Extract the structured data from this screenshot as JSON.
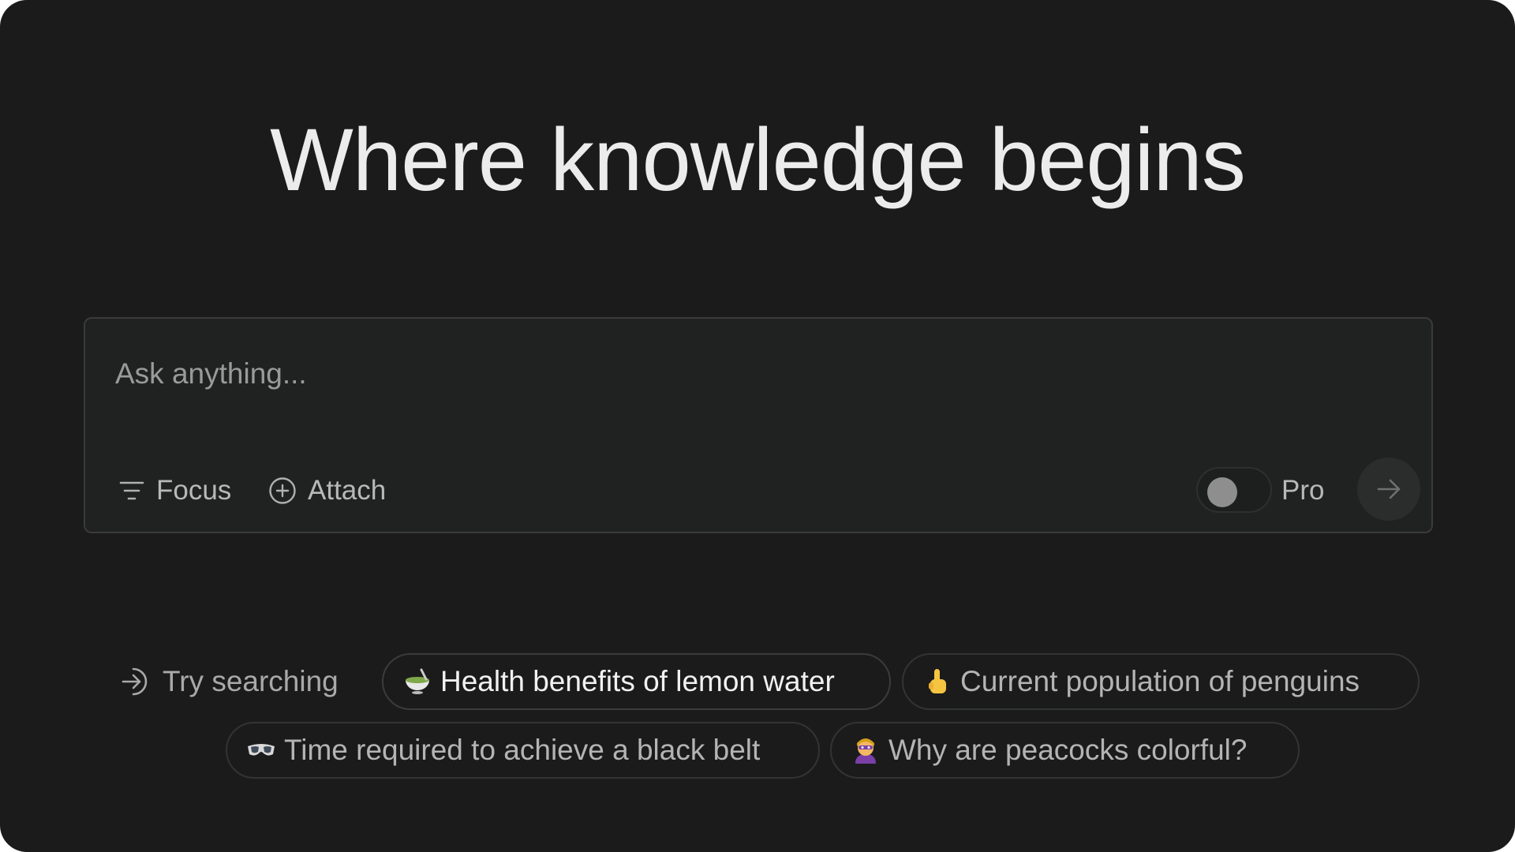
{
  "hero": {
    "title": "Where knowledge begins"
  },
  "ask": {
    "placeholder": "Ask anything...",
    "value": "",
    "focus_label": "Focus",
    "attach_label": "Attach",
    "pro_label": "Pro",
    "pro_enabled": false
  },
  "suggestions": {
    "label": "Try searching",
    "chips": [
      {
        "emoji": "bowl-with-spoon",
        "text": "Health benefits of lemon water",
        "hovered": true
      },
      {
        "emoji": "backhand-index-pointing-up",
        "text": "Current population of penguins",
        "hovered": false
      },
      {
        "emoji": "goggles",
        "text": "Time required to achieve a black belt",
        "hovered": false
      },
      {
        "emoji": "superhero",
        "text": "Why are peacocks colorful?",
        "hovered": false
      }
    ]
  },
  "colors": {
    "background": "#1b1b1b",
    "input_background": "#202222",
    "border": "#3a3a3a",
    "text_primary": "#ececec",
    "text_secondary": "#b4b4b4"
  },
  "icons": [
    "filter-icon",
    "plus-circle-icon",
    "arrow-right-icon",
    "arrow-right-in-icon"
  ]
}
